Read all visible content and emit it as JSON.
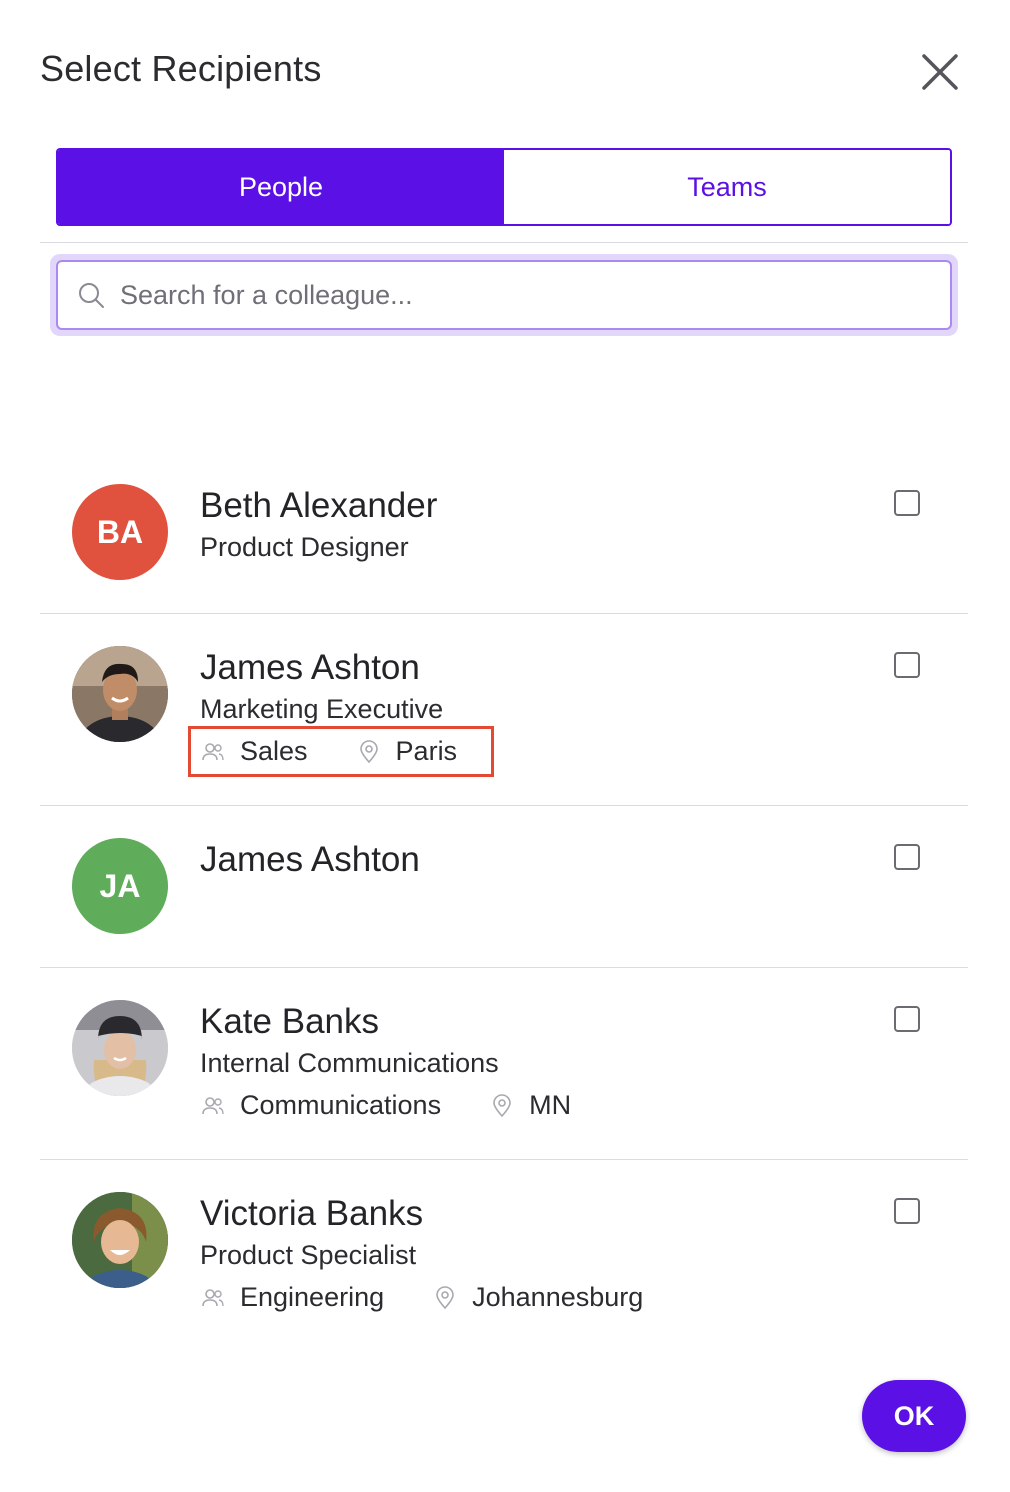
{
  "dialog": {
    "title": "Select Recipients"
  },
  "tabs": [
    {
      "label": "People",
      "active": true
    },
    {
      "label": "Teams",
      "active": false
    }
  ],
  "search": {
    "placeholder": "Search for a colleague..."
  },
  "people": [
    {
      "initials": "BA",
      "avatar_color": "#e0513e",
      "name": "Beth Alexander",
      "role": "Product Designer",
      "checked": false
    },
    {
      "initials": "",
      "avatar_kind": "photo",
      "name": "James Ashton",
      "role": "Marketing Executive",
      "team": "Sales",
      "location": "Paris",
      "checked": false,
      "highlighted": true
    },
    {
      "initials": "JA",
      "avatar_color": "#5fac5a",
      "name": "James Ashton",
      "checked": false
    },
    {
      "initials": "",
      "avatar_kind": "photo",
      "name": "Kate Banks",
      "role": "Internal Communications",
      "team": "Communications",
      "location": "MN",
      "checked": false
    },
    {
      "initials": "",
      "avatar_kind": "photo",
      "name": "Victoria Banks",
      "role": "Product Specialist",
      "team": "Engineering",
      "location": "Johannesburg",
      "checked": false
    }
  ],
  "footer": {
    "ok_label": "OK"
  },
  "colors": {
    "accent": "#5b10e6",
    "highlight_border": "#e34a34"
  }
}
